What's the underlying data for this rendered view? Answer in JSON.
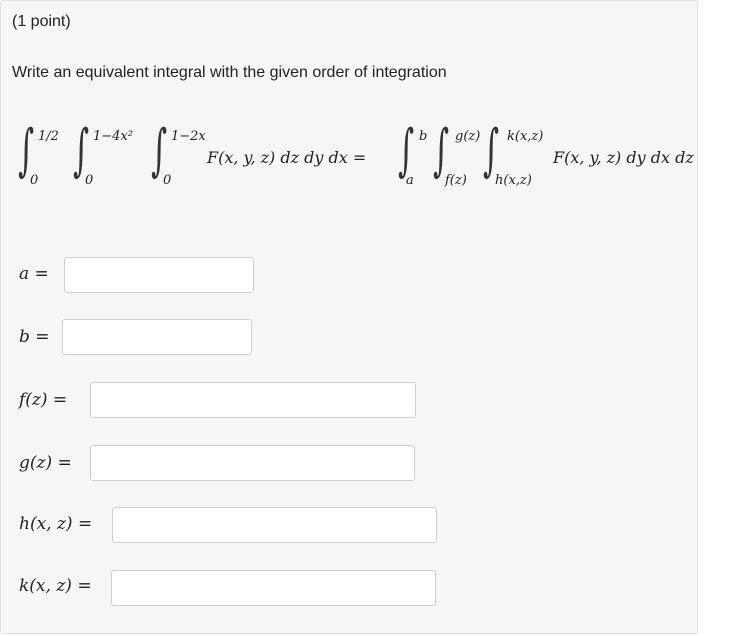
{
  "question": {
    "points": "(1 point)",
    "instruction": "Write an equivalent integral with the given order of integration"
  },
  "equation": {
    "left": {
      "int1_upper": "1/2",
      "int1_lower": "0",
      "int2_upper": "1−4x²",
      "int2_lower": "0",
      "int3_upper": "1−2x",
      "int3_lower": "0",
      "integrand": "F(x, y, z) dz dy dx ="
    },
    "right": {
      "int1_upper": "b",
      "int1_lower": "a",
      "int2_upper": "g(z)",
      "int2_lower": "f(z)",
      "int3_upper": "k(x,z)",
      "int3_lower": "h(x,z)",
      "integrand": "F(x, y, z) dy dx dz"
    }
  },
  "answers": [
    {
      "label": "a =",
      "value": ""
    },
    {
      "label": "b =",
      "value": ""
    },
    {
      "label": "f(z) =",
      "value": ""
    },
    {
      "label": "g(z) =",
      "value": ""
    },
    {
      "label": "h(x, z) =",
      "value": ""
    },
    {
      "label": "k(x, z) =",
      "value": ""
    }
  ]
}
